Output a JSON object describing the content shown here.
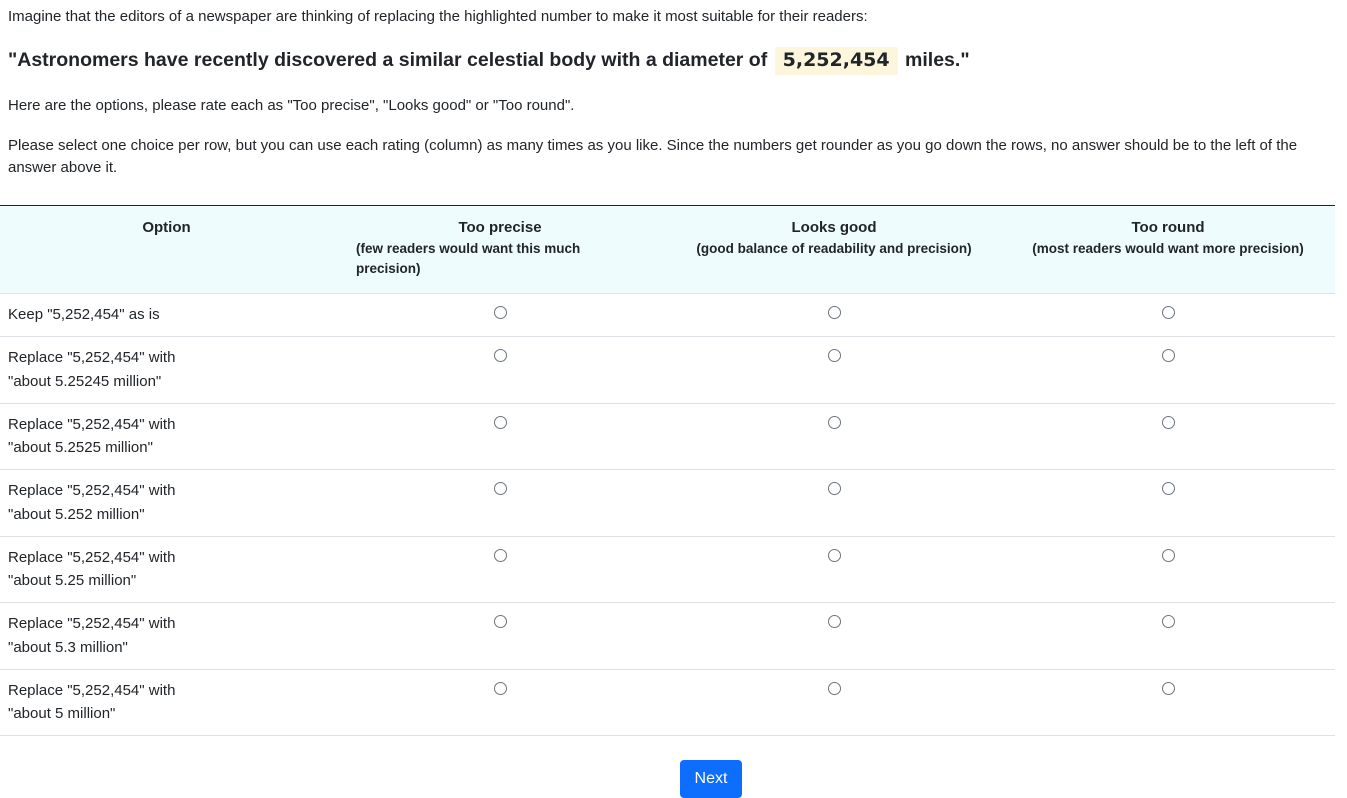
{
  "intro": "Imagine that the editors of a newspaper are thinking of replacing the highlighted number to make it most suitable for their readers:",
  "sentence": {
    "before": "\"Astronomers have recently discovered a similar celestial body with a diameter of",
    "highlight": "5,252,454",
    "after": "miles.\""
  },
  "instructions": {
    "options_line": "Here are the options, please rate each as \"Too precise\", \"Looks good\" or \"Too round\".",
    "select_line": "Please select one choice per row, but you can use each rating (column) as many times as you like. Since the numbers get rounder as you go down the rows, no answer should be to the left of the answer above it."
  },
  "table": {
    "header": {
      "option": "Option",
      "too_precise": "Too precise",
      "too_precise_sub": "(few readers would want this much precision)",
      "looks_good": "Looks good",
      "looks_good_sub": "(good balance of readability and precision)",
      "too_round": "Too round",
      "too_round_sub": "(most readers would want more precision)"
    },
    "rows": [
      {
        "line1": "Keep \"5,252,454\" as is",
        "line2": ""
      },
      {
        "line1": "Replace \"5,252,454\" with",
        "line2": "\"about 5.25245 million\""
      },
      {
        "line1": "Replace \"5,252,454\" with",
        "line2": "\"about 5.2525 million\""
      },
      {
        "line1": "Replace \"5,252,454\" with",
        "line2": "\"about 5.252 million\""
      },
      {
        "line1": "Replace \"5,252,454\" with",
        "line2": "\"about 5.25 million\""
      },
      {
        "line1": "Replace \"5,252,454\" with",
        "line2": "\"about 5.3 million\""
      },
      {
        "line1": "Replace \"5,252,454\" with",
        "line2": "\"about 5 million\""
      }
    ]
  },
  "next_label": "Next",
  "colors": {
    "header_bg": "#eefcfd",
    "highlight_bg": "#fdf5dc",
    "button_bg": "#0d6efd"
  }
}
